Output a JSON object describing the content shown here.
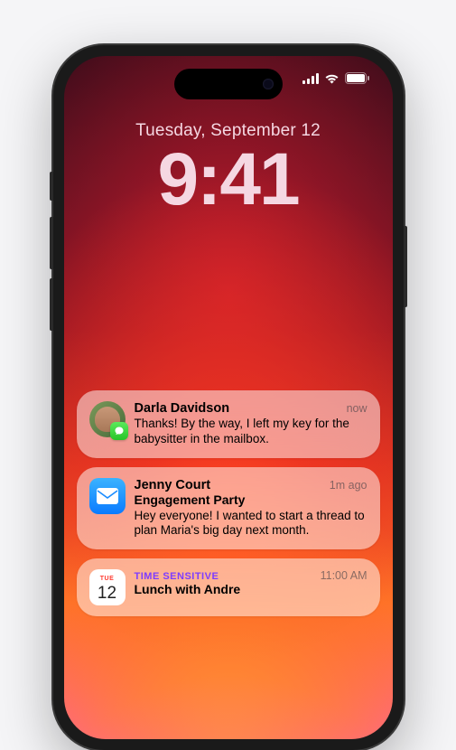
{
  "statusbar": {
    "signal_bars": 4,
    "wifi_bars": 3
  },
  "lockscreen": {
    "date": "Tuesday, September 12",
    "time": "9:41"
  },
  "notifications": [
    {
      "app": "messages",
      "sender": "Darla Davidson",
      "timestamp": "now",
      "body": "Thanks! By the way, I left my key for the babysitter in the mailbox."
    },
    {
      "app": "mail",
      "sender": "Jenny Court",
      "subject": "Engagement Party",
      "timestamp": "1m ago",
      "body": "Hey everyone! I wanted to start a thread to plan Maria's big day next month."
    },
    {
      "app": "calendar",
      "badge": "TIME SENSITIVE",
      "title": "Lunch with Andre",
      "timestamp": "11:00 AM",
      "cal_day_label": "TUE",
      "cal_day_num": "12"
    }
  ]
}
